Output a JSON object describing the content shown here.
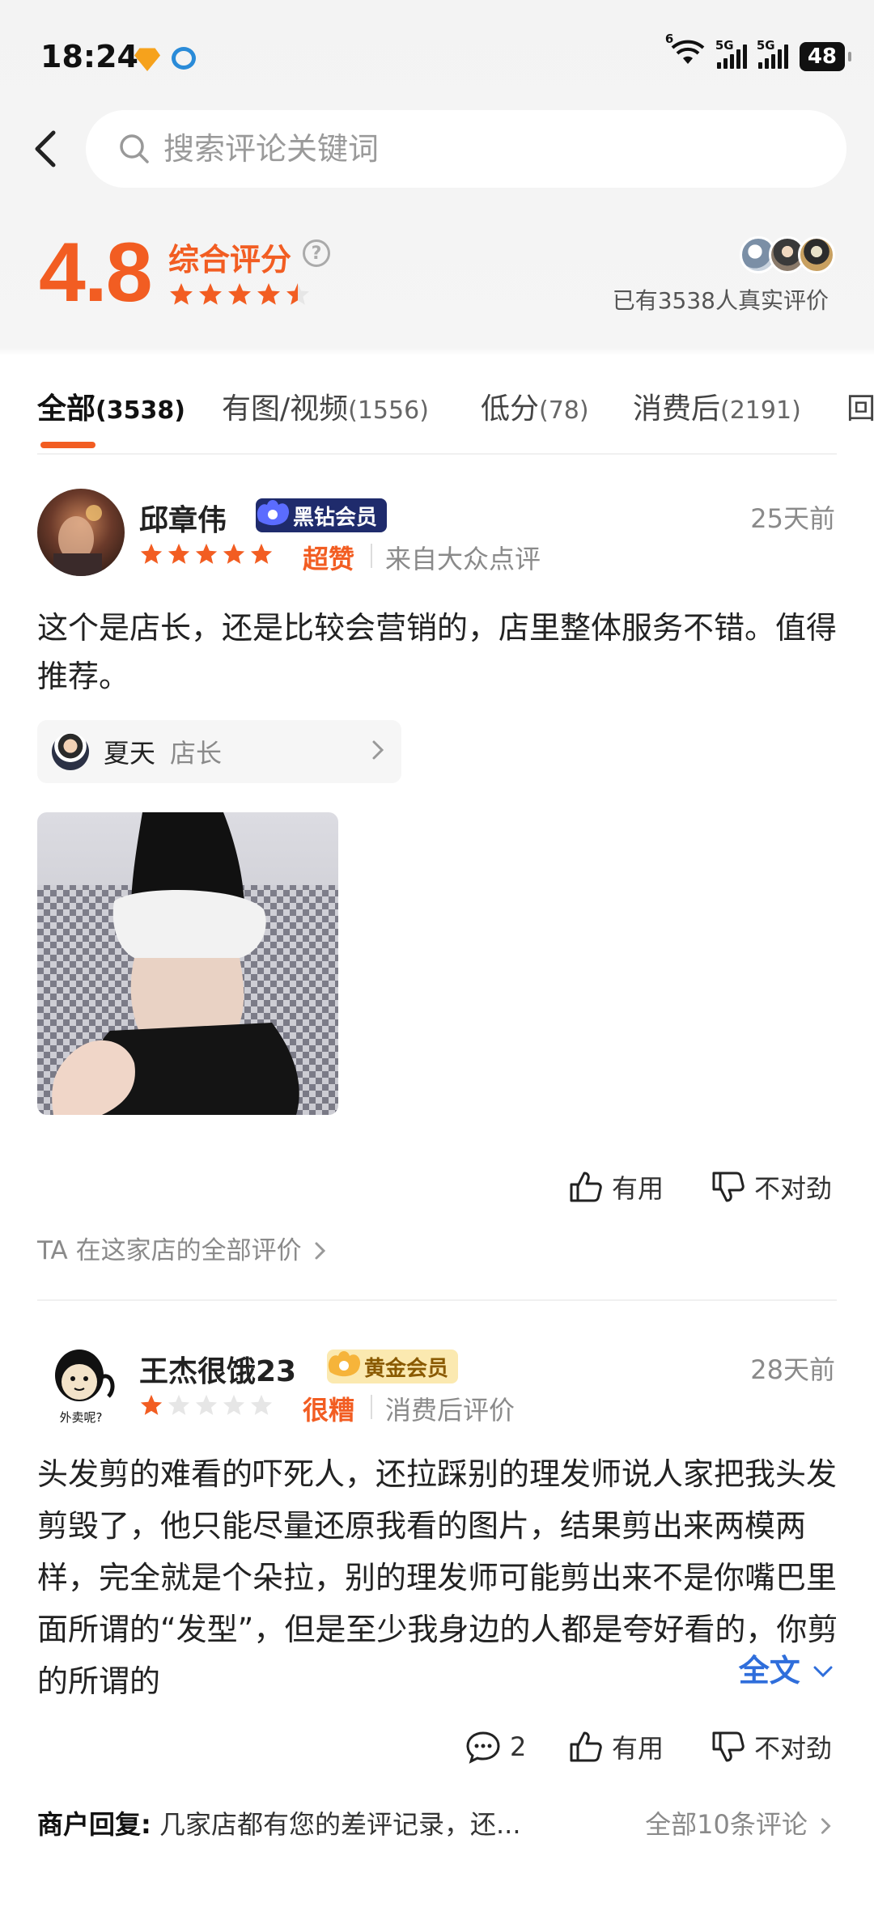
{
  "status_bar": {
    "time": "18:24",
    "signal_1": "5G",
    "signal_2": "5G",
    "wifi_badge": "6",
    "battery": "48"
  },
  "search": {
    "placeholder": "搜索评论关键词"
  },
  "rating": {
    "score": "4.8",
    "label": "综合评分",
    "stars": 4.5,
    "real_reviews": "已有3538人真实评价"
  },
  "tabs": [
    {
      "label": "全部",
      "count": "(3538)"
    },
    {
      "label": "有图/视频",
      "count": "(1556)"
    },
    {
      "label": "低分",
      "count": "(78)"
    },
    {
      "label": "消费后",
      "count": "(2191)"
    },
    {
      "label": "回",
      "count": ""
    }
  ],
  "reviews": [
    {
      "user": "邱章伟",
      "member": "黑钻会员",
      "time": "25天前",
      "stars": 5,
      "rating_word": "超赞",
      "source": "来自大众点评",
      "text": "这个是店长，还是比较会营销的，店里整体服务不错。值得推荐。",
      "staff_name": "夏天",
      "staff_role": "店长",
      "useful": "有用",
      "not_right": "不对劲",
      "all_reviews_link": "TA 在这家店的全部评价"
    },
    {
      "user": "王杰很饿23",
      "member": "黄金会员",
      "avatar_caption": "外卖呢?",
      "time": "28天前",
      "stars": 1,
      "rating_word": "很糟",
      "source": "消费后评价",
      "text": "头发剪的难看的吓死人，还拉踩别的理发师说人家把我头发剪毁了，他只能尽量还原我看的图片，结果剪出来两模两样，完全就是个朵拉，别的理发师可能剪出来不是你嘴巴里面所谓的“发型”，但是至少我身边的人都是夸好看的，你剪的所谓的",
      "full_text": "全文",
      "comments": "2",
      "useful": "有用",
      "not_right": "不对劲",
      "reply_label": "商户回复:",
      "reply_text": "几家店都有您的差评记录，还...",
      "reply_more": "全部10条评论"
    }
  ],
  "colors": {
    "accent": "#f25d22",
    "link_blue": "#2f6edb"
  }
}
